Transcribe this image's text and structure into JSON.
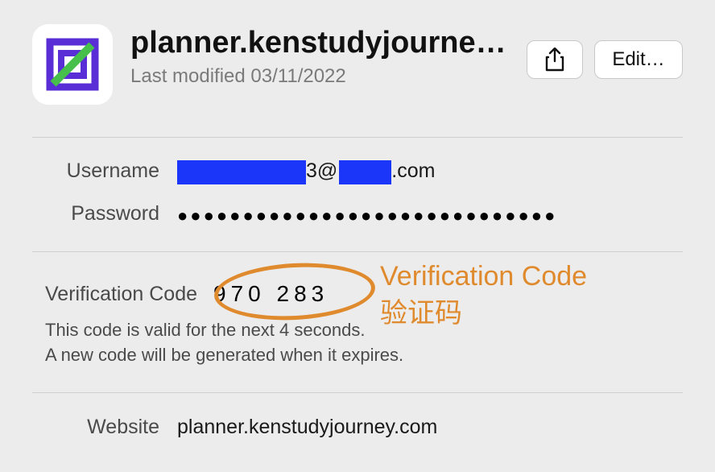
{
  "header": {
    "title": "planner.kenstudyjourne…",
    "subtitle": "Last modified 03/11/2022",
    "edit_label": "Edit…"
  },
  "fields": {
    "username_label": "Username",
    "username_at": "3@",
    "username_suffix": ".com",
    "password_label": "Password",
    "password_mask": "●●●●●●●●●●●●●●●●●●●●●●●●●●●●●"
  },
  "verification": {
    "label": "Verification Code",
    "code": "970 283",
    "note1": "This code is valid for the next 4 seconds.",
    "note2": "A new code will be generated when it expires.",
    "annotation_en": "Verification Code",
    "annotation_zh": "验证码"
  },
  "website": {
    "label": "Website",
    "value": "planner.kenstudyjourney.com"
  }
}
